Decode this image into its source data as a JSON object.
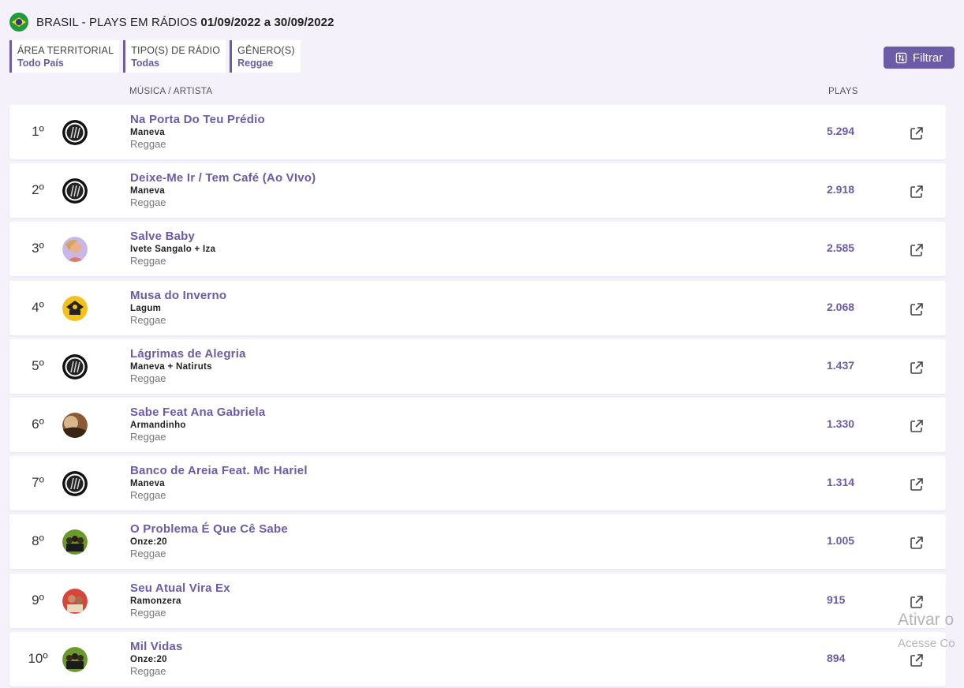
{
  "header": {
    "country": "BRASIL",
    "title": "BRASIL - PLAYS EM RÁDIOS",
    "dates": "01/09/2022 a 30/09/2022"
  },
  "filters": [
    {
      "label": "ÁREA TERRITORIAL",
      "value": "Todo País"
    },
    {
      "label": "TIPO(S) DE RÁDIO",
      "value": "Todas"
    },
    {
      "label": "GÊNERO(S)",
      "value": "Reggae"
    }
  ],
  "filter_button": "Filtrar",
  "columns": {
    "song_artist": "MÚSICA / ARTISTA",
    "plays": "PLAYS"
  },
  "rows": [
    {
      "rank": "1º",
      "song": "Na Porta Do Teu Prédio",
      "artist": "Maneva",
      "genre": "Reggae",
      "plays": "5.294",
      "avatar": "maneva"
    },
    {
      "rank": "2º",
      "song": "Deixe-Me Ir / Tem Café (Ao VIvo)",
      "artist": "Maneva",
      "genre": "Reggae",
      "plays": "2.918",
      "avatar": "maneva"
    },
    {
      "rank": "3º",
      "song": "Salve Baby",
      "artist": "Ivete Sangalo + Iza",
      "genre": "Reggae",
      "plays": "2.585",
      "avatar": "ivete"
    },
    {
      "rank": "4º",
      "song": "Musa do Inverno",
      "artist": "Lagum",
      "genre": "Reggae",
      "plays": "2.068",
      "avatar": "lagum"
    },
    {
      "rank": "5º",
      "song": "Lágrimas de Alegria",
      "artist": "Maneva + Natiruts",
      "genre": "Reggae",
      "plays": "1.437",
      "avatar": "maneva"
    },
    {
      "rank": "6º",
      "song": "Sabe Feat Ana Gabriela",
      "artist": "Armandinho",
      "genre": "Reggae",
      "plays": "1.330",
      "avatar": "armandinho"
    },
    {
      "rank": "7º",
      "song": "Banco de Areia Feat. Mc Hariel",
      "artist": "Maneva",
      "genre": "Reggae",
      "plays": "1.314",
      "avatar": "maneva"
    },
    {
      "rank": "8º",
      "song": "O Problema É Que Cê Sabe",
      "artist": "Onze:20",
      "genre": "Reggae",
      "plays": "1.005",
      "avatar": "onze20"
    },
    {
      "rank": "9º",
      "song": "Seu Atual Vira Ex",
      "artist": "Ramonzera",
      "genre": "Reggae",
      "plays": "915",
      "avatar": "ramonzera"
    },
    {
      "rank": "10º",
      "song": "Mil Vidas",
      "artist": "Onze:20",
      "genre": "Reggae",
      "plays": "894",
      "avatar": "onze20"
    }
  ],
  "watermark": {
    "line1": "Ativar o",
    "line2": "Acesse Co"
  },
  "colors": {
    "accent": "#6c5ba7",
    "background": "#f4f1fb"
  }
}
